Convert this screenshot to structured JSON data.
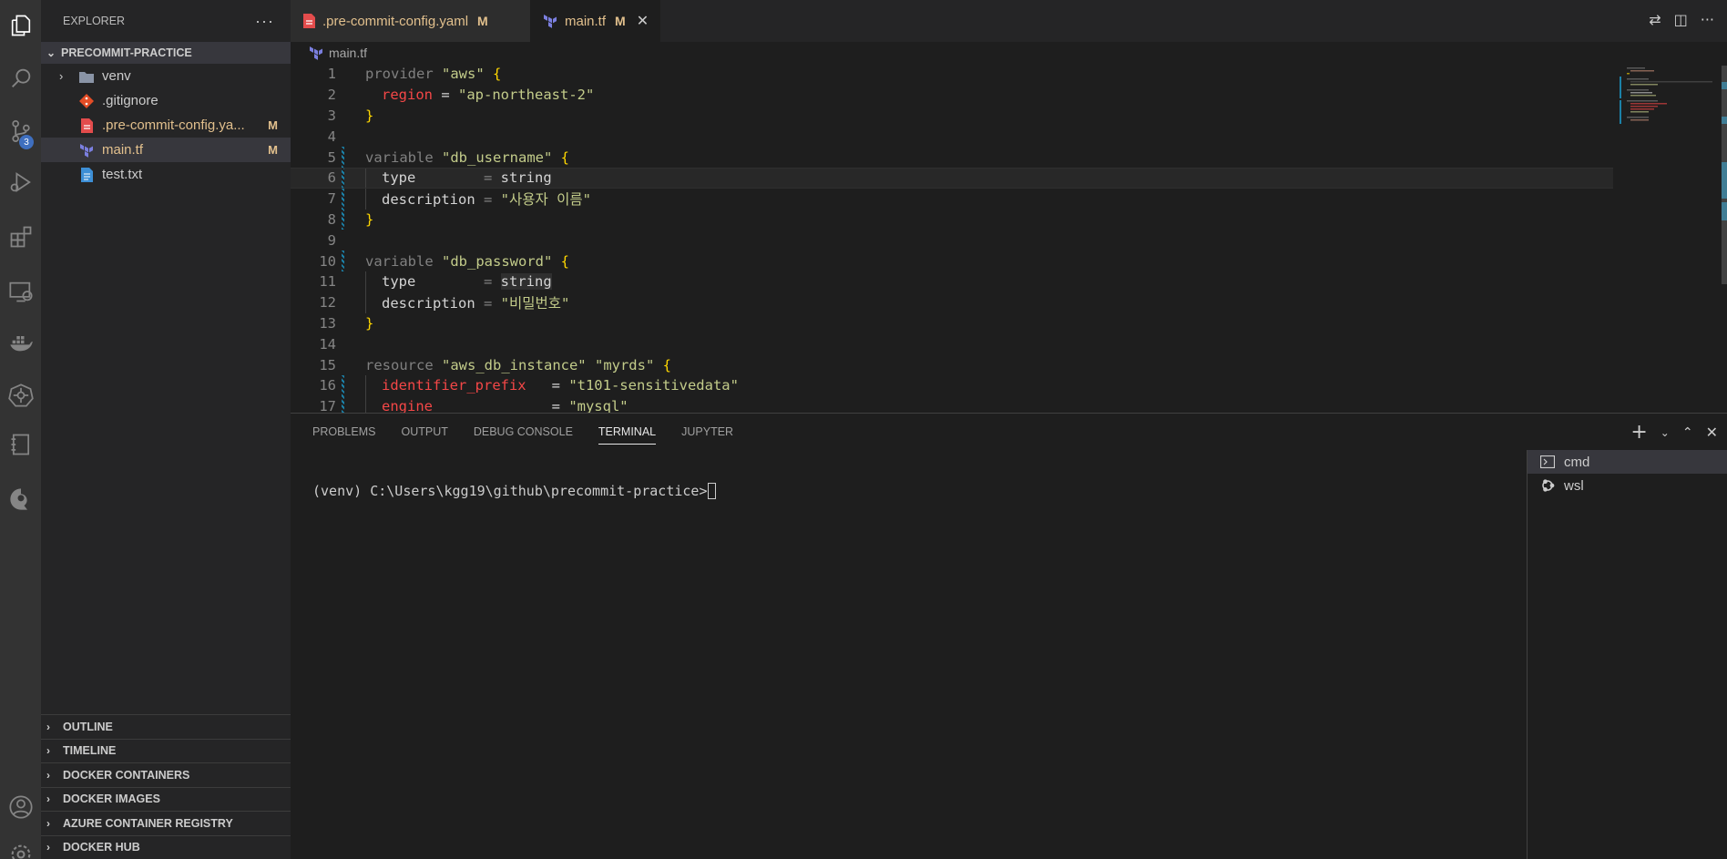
{
  "sidebar": {
    "title": "EXPLORER",
    "more": "···",
    "folder": "PRECOMMIT-PRACTICE",
    "items": [
      {
        "name": "venv",
        "type": "folder",
        "mark": ""
      },
      {
        "name": ".gitignore",
        "type": "git",
        "mark": ""
      },
      {
        "name": ".pre-commit-config.ya...",
        "type": "yaml",
        "mark": "M"
      },
      {
        "name": "main.tf",
        "type": "terraform",
        "mark": "M"
      },
      {
        "name": "test.txt",
        "type": "text",
        "mark": ""
      }
    ],
    "sections": [
      "OUTLINE",
      "TIMELINE",
      "DOCKER CONTAINERS",
      "DOCKER IMAGES",
      "AZURE CONTAINER REGISTRY",
      "DOCKER HUB"
    ]
  },
  "activity": {
    "scm_badge": "3"
  },
  "tabs": [
    {
      "label": ".pre-commit-config.yaml",
      "mark": "M"
    },
    {
      "label": "main.tf",
      "mark": "M",
      "close": "✕"
    }
  ],
  "breadcrumb": "main.tf",
  "editor": {
    "lines": [
      {
        "n": "1"
      },
      {
        "n": "2"
      },
      {
        "n": "3"
      },
      {
        "n": "4"
      },
      {
        "n": "5"
      },
      {
        "n": "6"
      },
      {
        "n": "7"
      },
      {
        "n": "8"
      },
      {
        "n": "9"
      },
      {
        "n": "10"
      },
      {
        "n": "11"
      },
      {
        "n": "12"
      },
      {
        "n": "13"
      },
      {
        "n": "14"
      },
      {
        "n": "15"
      },
      {
        "n": "16"
      },
      {
        "n": "17"
      }
    ],
    "code": {
      "l1_kw": "provider",
      "l1_str": "\"aws\"",
      "l2_attr": "region",
      "l2_eq": " = ",
      "l2_str": "\"ap-northeast-2\"",
      "l5_kw": "variable",
      "l5_str": "\"db_username\"",
      "l6_prop": "type",
      "l6_eq": "        = ",
      "l6_val": "string",
      "l7_prop": "description",
      "l7_eq": " = ",
      "l7_str": "\"사용자 이름\"",
      "l10_kw": "variable",
      "l10_str": "\"db_password\"",
      "l11_prop": "type",
      "l11_eq": "        = ",
      "l11_val": "string",
      "l12_prop": "description",
      "l12_eq": " = ",
      "l12_str": "\"비밀번호\"",
      "l15_kw": "resource",
      "l15_str1": "\"aws_db_instance\"",
      "l15_str2": "\"myrds\"",
      "l16_attr": "identifier_prefix",
      "l16_eq": "   = ",
      "l16_str": "\"t101-sensitivedata\"",
      "l17_attr": "engine",
      "l17_eq": "              = ",
      "l17_str": "\"mysql\"",
      "open_brace": " {",
      "close_brace": "}"
    }
  },
  "panel": {
    "tabs": [
      "PROBLEMS",
      "OUTPUT",
      "DEBUG CONSOLE",
      "TERMINAL",
      "JUPYTER"
    ],
    "active_tab": "TERMINAL",
    "prompt": "(venv) C:\\Users\\kgg19\\github\\precommit-practice>",
    "terminals": [
      "cmd",
      "wsl"
    ]
  }
}
